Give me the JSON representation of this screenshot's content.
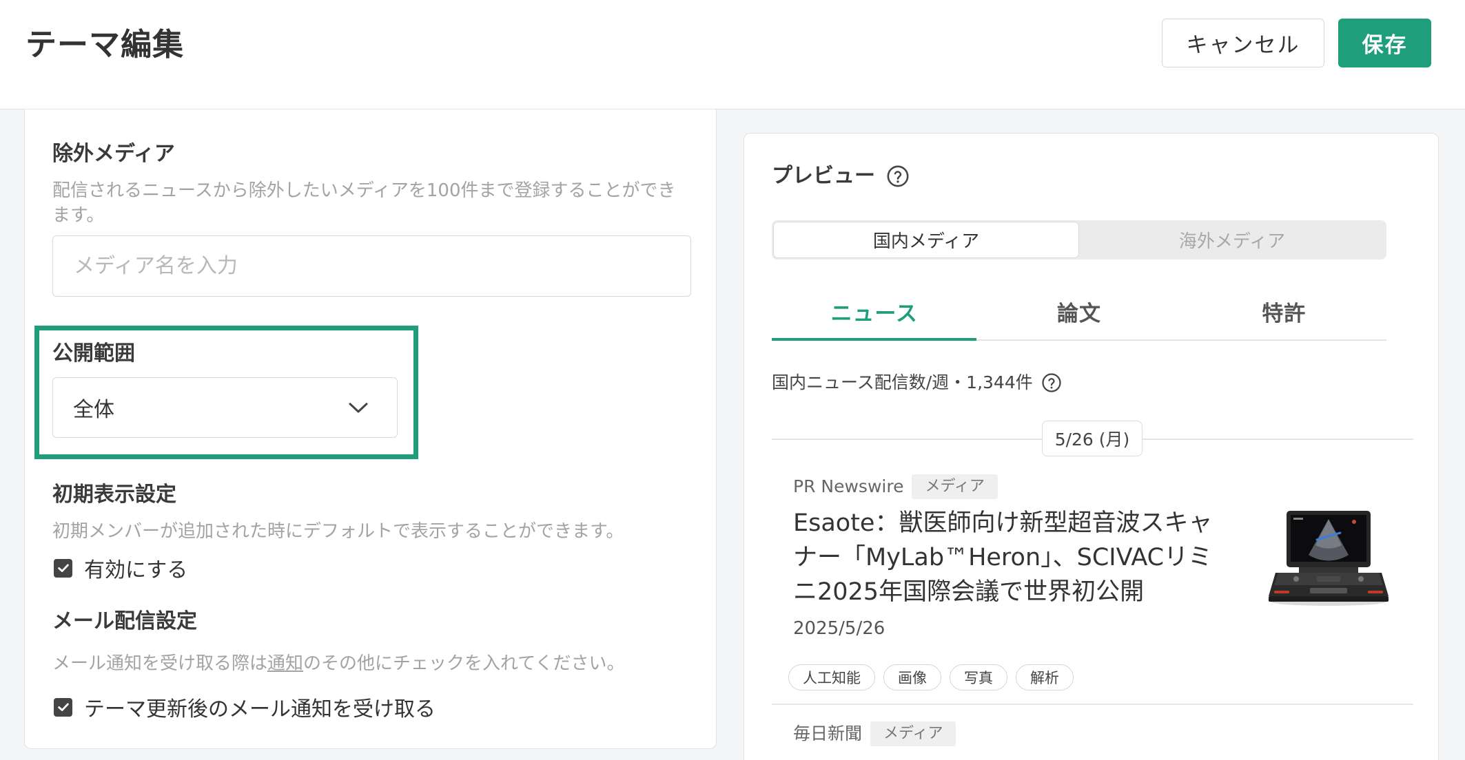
{
  "colors": {
    "accent": "#1f9e7b",
    "page_background": "#f4f5f6",
    "muted_text": "#a3a3a3"
  },
  "icons": {
    "help": "help-circle-icon",
    "dropdown": "chevron-down-icon",
    "checkbox": "checkbox-checked-icon"
  },
  "header": {
    "title": "テーマ編集",
    "cancel_label": "キャンセル",
    "save_label": "保存"
  },
  "settings": {
    "excluded_media": {
      "heading": "除外メディア",
      "description": "配信されるニュースから除外したいメディアを100件まで登録することができます。",
      "input_placeholder": "メディア名を入力"
    },
    "visibility": {
      "heading": "公開範囲",
      "selected_option": "全体"
    },
    "initial_display": {
      "heading": "初期表示設定",
      "description": "初期メンバーが追加された時にデフォルトで表示することができます。",
      "checkbox_label": "有効にする",
      "checked": true
    },
    "mail_delivery": {
      "heading": "メール配信設定",
      "description_before": "メール通知を受け取る際は",
      "description_link": "通知",
      "description_after": "のその他にチェックを入れてください。",
      "checkbox_label": "テーマ更新後のメール通知を受け取る",
      "checked": true
    }
  },
  "preview": {
    "heading": "プレビュー",
    "active_segment_index": 0,
    "segments": [
      {
        "label": "国内メディア"
      },
      {
        "label": "海外メディア"
      }
    ],
    "active_tab_index": 0,
    "tabs": [
      {
        "label": "ニュース"
      },
      {
        "label": "論文"
      },
      {
        "label": "特許"
      }
    ],
    "weekly_count_text": "国内ニュース配信数/週・1,344件",
    "date_label": "5/26 (月)",
    "articles": [
      {
        "source": "PR Newswire",
        "source_type": "メディア",
        "title": "Esaote：獣医師向け新型超音波スキャナー「MyLab™Heron」、SCIVACリミニ2025年国際会議で世界初公開",
        "date": "2025/5/26",
        "tags": [
          "人工知能",
          "画像",
          "写真",
          "解析"
        ]
      },
      {
        "source": "毎日新聞",
        "source_type": "メディア"
      }
    ]
  }
}
